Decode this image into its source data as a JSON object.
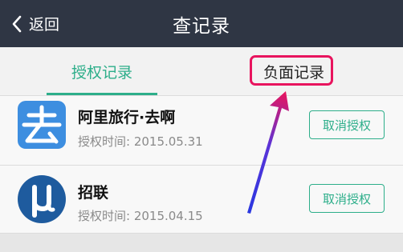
{
  "header": {
    "back_label": "返回",
    "title": "查记录"
  },
  "tabs": [
    {
      "label": "授权记录",
      "active": true
    },
    {
      "label": "负面记录",
      "active": false,
      "highlighted": true
    }
  ],
  "records": [
    {
      "app_name": "阿里旅行·去啊",
      "auth_time": "授权时间: 2015.05.31",
      "action_label": "取消授权",
      "icon": "alitrip-qu-icon"
    },
    {
      "app_name": "招联",
      "auth_time": "授权时间: 2015.04.15",
      "action_label": "取消授权",
      "icon": "zhaolian-mu-icon"
    }
  ],
  "colors": {
    "header_bg": "#2f3644",
    "accent_green": "#2dae8a",
    "highlight_pink": "#e8145e",
    "arrow_blue": "#2a37e0"
  }
}
